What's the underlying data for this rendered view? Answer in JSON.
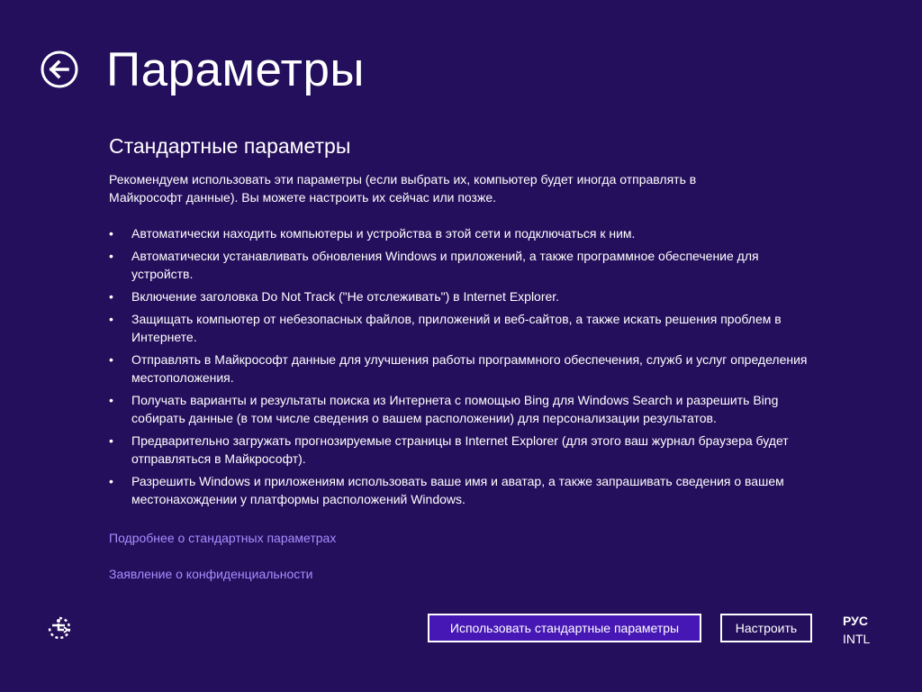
{
  "header": {
    "title": "Параметры"
  },
  "section": {
    "title": "Стандартные параметры",
    "intro": "Рекомендуем использовать эти параметры (если выбрать их, компьютер будет иногда отправлять в Майкрософт данные). Вы можете настроить их сейчас или позже."
  },
  "bullet_char": "•",
  "bullets": [
    "Автоматически находить компьютеры и устройства в этой сети и подключаться к ним.",
    "Автоматически устанавливать обновления Windows и приложений, а также программное обеспечение для устройств.",
    "Включение заголовка Do Not Track (\"Не отслеживать\") в Internet Explorer.",
    "Защищать компьютер от небезопасных файлов, приложений и веб-сайтов, а также искать решения проблем в Интернете.",
    "Отправлять в Майкрософт данные для улучшения работы программного обеспечения, служб и услуг определения местоположения.",
    "Получать варианты и результаты поиска из Интернета с помощью Bing для Windows Search и разрешить Bing собирать данные (в том числе сведения о вашем расположении) для персонализации результатов.",
    "Предварительно загружать прогнозируемые страницы в Internet Explorer (для этого ваш журнал браузера будет отправляться в Майкрософт).",
    "Разрешить Windows и приложениям использовать ваше имя и аватар, а также запрашивать сведения о вашем местонахождении у платформы расположений Windows."
  ],
  "links": {
    "learn_more": "Подробнее о стандартных параметрах",
    "privacy": "Заявление о конфиденциальности"
  },
  "buttons": {
    "use_express": "Использовать стандартные параметры",
    "customize": "Настроить"
  },
  "language": {
    "main": "РУС",
    "sub": "INTL"
  },
  "icons": {
    "back": "back-arrow-icon",
    "ease_of_access": "ease-of-access-icon"
  },
  "colors": {
    "background": "#240f5c",
    "primary_button": "#4617b4",
    "link": "#a98cff"
  }
}
